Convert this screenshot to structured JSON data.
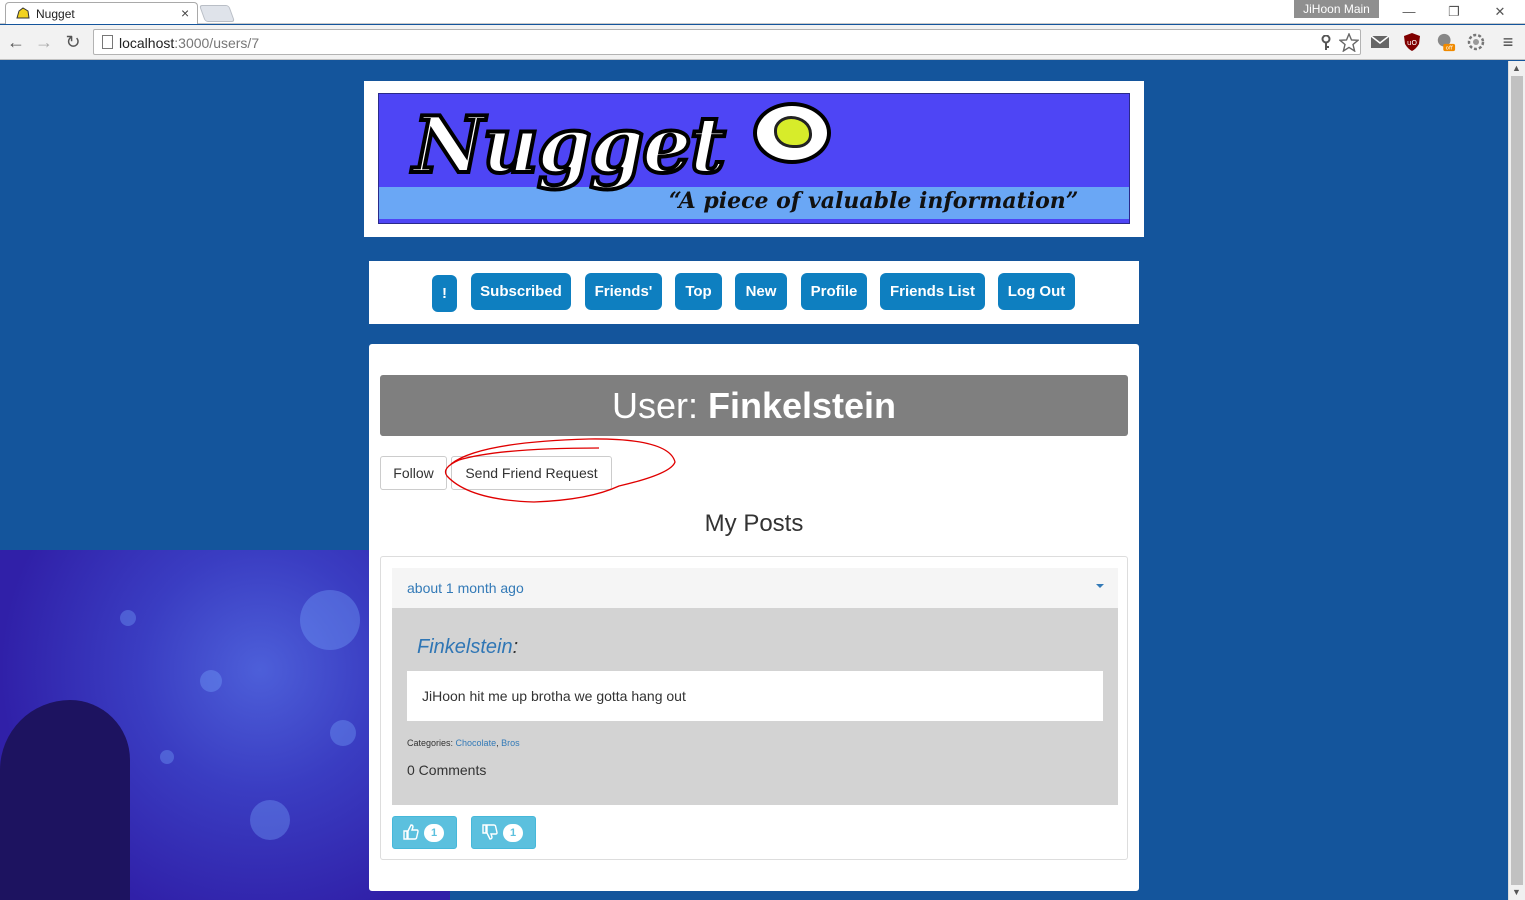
{
  "browser": {
    "tab_title": "Nugget",
    "tab_close": "×",
    "profile_name": "JiHoon Main",
    "url_host": "localhost",
    "url_path": ":3000/users/7",
    "window_minimize": "—",
    "window_restore": "❐",
    "window_close": "✕",
    "back_glyph": "←",
    "forward_glyph": "→",
    "reload_glyph": "↻",
    "menu_glyph": "≡"
  },
  "banner": {
    "logo": "Nugget",
    "tagline": "“A piece of valuable information”"
  },
  "nav": {
    "items": [
      {
        "label": "!"
      },
      {
        "label": "Subscribed"
      },
      {
        "label": "Friends'"
      },
      {
        "label": "Top"
      },
      {
        "label": "New"
      },
      {
        "label": "Profile"
      },
      {
        "label": "Friends List"
      },
      {
        "label": "Log Out"
      }
    ]
  },
  "profile": {
    "heading_prefix": "User:",
    "username": "Finkelstein",
    "follow_label": "Follow",
    "friend_request_label": "Send Friend Request",
    "section_title": "My Posts"
  },
  "post": {
    "timestamp": "about 1 month ago",
    "author": "Finkelstein",
    "author_suffix": ":",
    "text": "JiHoon hit me up brotha we gotta hang out",
    "categories_label": "Categories:",
    "categories": [
      "Chocolate",
      "Bros"
    ],
    "category_separator": ", ",
    "comments": "0 Comments",
    "upvotes": "1",
    "downvotes": "1"
  },
  "colors": {
    "page_bg": "#14559c",
    "nav_pill": "#0e7fc0",
    "header_bar": "#7f7f7f",
    "vote_button": "#5bc0de",
    "link": "#337ab7",
    "annotation": "#e00000"
  }
}
